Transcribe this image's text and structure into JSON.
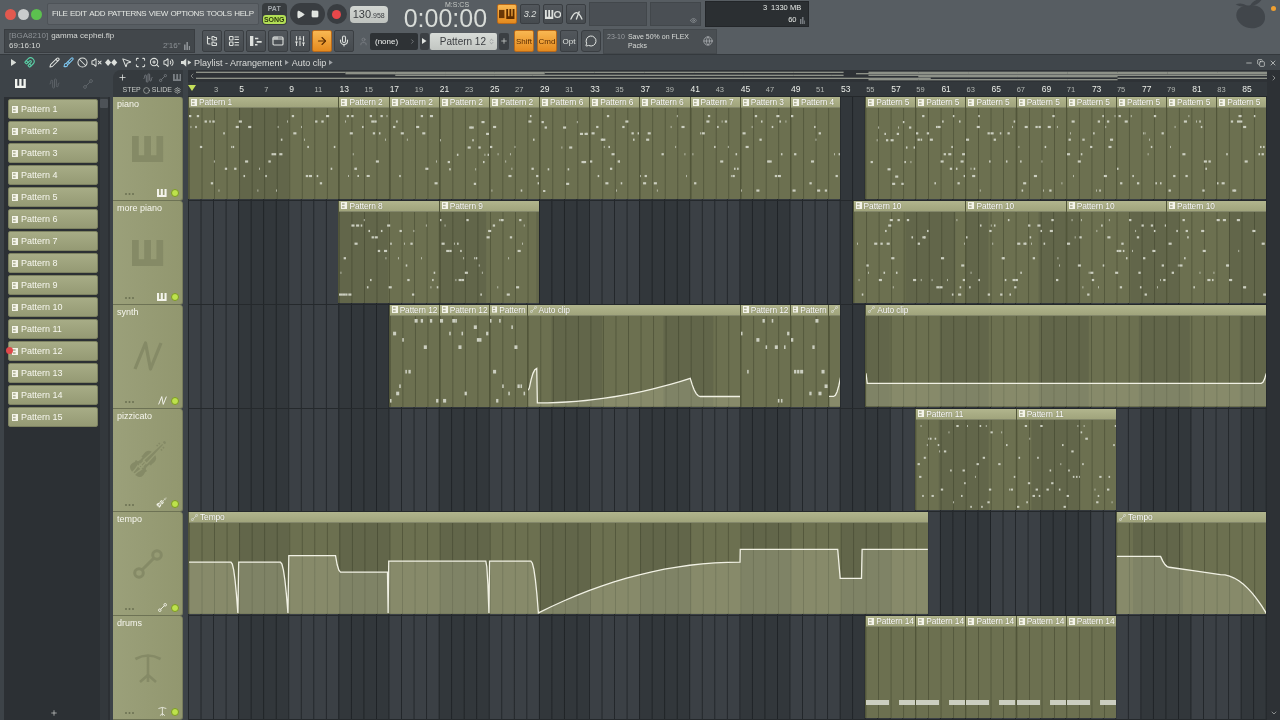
{
  "menu": [
    "FILE",
    "EDIT",
    "ADD",
    "PATTERNS",
    "VIEW",
    "OPTIONS",
    "TOOLS",
    "HELP"
  ],
  "transport": {
    "modes": [
      {
        "label": "PAT",
        "selected": false
      },
      {
        "label": "SONG",
        "selected": true
      }
    ],
    "tempo": "130",
    "tempo_fraction": ".958",
    "time_format": "M:S:CS",
    "time": "0:00:00"
  },
  "view_buttons": [
    {
      "kind": "keyboard",
      "on": true
    },
    {
      "kind": "countdown",
      "label": "3.2",
      "on": false
    },
    {
      "kind": "loop",
      "on": false
    },
    {
      "kind": "metronome",
      "on": false
    }
  ],
  "performance": {
    "cpu": "3",
    "memory": "1330 MB",
    "polyphony": "60"
  },
  "project": {
    "id": "[BGA8210]",
    "file": "gamma cephei.flp",
    "position": "69:16:10",
    "length": "2'16\""
  },
  "window_buttons": [
    {
      "kind": "browser",
      "on": false
    },
    {
      "kind": "channel_rack",
      "on": false
    },
    {
      "kind": "piano_roll",
      "on": false
    },
    {
      "kind": "playlist",
      "on": false
    },
    {
      "kind": "mixer",
      "on": false
    },
    {
      "kind": "arrow",
      "on": true
    },
    {
      "kind": "mic",
      "on": false
    }
  ],
  "channel_selector": "(none)",
  "pattern_selector": "Pattern 12",
  "modifier_keys": [
    {
      "label": "Shift",
      "on": true
    },
    {
      "label": "Cmd",
      "on": true
    },
    {
      "label": "Opt",
      "on": false
    }
  ],
  "news": {
    "date": "23-10",
    "text": "Save 50% on FLEX Packs"
  },
  "playlist": {
    "snap": {
      "on": true
    },
    "tools": [
      {
        "kind": "draw",
        "selected": false
      },
      {
        "kind": "paint",
        "selected": true
      },
      {
        "kind": "delete",
        "selected": false
      },
      {
        "kind": "mute",
        "selected": false
      },
      {
        "kind": "slip",
        "selected": false
      },
      {
        "kind": "select",
        "selected": false
      },
      {
        "kind": "zoom_fit",
        "selected": false
      },
      {
        "kind": "zoom",
        "selected": false
      },
      {
        "kind": "playback",
        "selected": false
      }
    ],
    "breadcrumb": [
      "Playlist - Arrangement",
      "Auto clip"
    ],
    "picker_tabs": [
      {
        "kind": "patterns",
        "selected": true
      },
      {
        "kind": "audio",
        "selected": false
      },
      {
        "kind": "automation",
        "selected": false
      }
    ],
    "patterns": [
      {
        "name": "Pattern 1",
        "selected": false
      },
      {
        "name": "Pattern 2",
        "selected": false
      },
      {
        "name": "Pattern 3",
        "selected": false
      },
      {
        "name": "Pattern 4",
        "selected": false
      },
      {
        "name": "Pattern 5",
        "selected": false
      },
      {
        "name": "Pattern 6",
        "selected": false
      },
      {
        "name": "Pattern 7",
        "selected": false
      },
      {
        "name": "Pattern 8",
        "selected": false
      },
      {
        "name": "Pattern 9",
        "selected": false
      },
      {
        "name": "Pattern 10",
        "selected": false
      },
      {
        "name": "Pattern 11",
        "selected": false
      },
      {
        "name": "Pattern 12",
        "selected": true
      },
      {
        "name": "Pattern 13",
        "selected": false
      },
      {
        "name": "Pattern 14",
        "selected": false
      },
      {
        "name": "Pattern 15",
        "selected": false
      }
    ],
    "header_options": {
      "step": "STEP",
      "slide": "SLIDE"
    },
    "ruler": [
      "3",
      "5",
      "7",
      "9",
      "11",
      "13",
      "15",
      "17",
      "19",
      "21",
      "23",
      "25",
      "27",
      "29",
      "31",
      "33",
      "35",
      "37",
      "39",
      "41",
      "43",
      "45",
      "47",
      "49",
      "51",
      "53",
      "55",
      "57",
      "59",
      "61",
      "63",
      "65",
      "67",
      "69",
      "71",
      "73",
      "75",
      "77",
      "79",
      "81",
      "83",
      "85"
    ],
    "tracks": [
      {
        "name": "piano",
        "kind": "piano",
        "active": true,
        "clips": [
          {
            "kind": "pattern",
            "label": "Pattern 1"
          },
          {
            "kind": "pattern",
            "label": "Pattern 2"
          },
          {
            "kind": "pattern",
            "label": "Pattern 2"
          },
          {
            "kind": "pattern",
            "label": "Pattern 2"
          },
          {
            "kind": "pattern",
            "label": "Pattern 2"
          },
          {
            "kind": "pattern",
            "label": "Pattern 6"
          },
          {
            "kind": "pattern",
            "label": "Pattern 6"
          },
          {
            "kind": "pattern",
            "label": "Pattern 6"
          },
          {
            "kind": "pattern",
            "label": "Pattern 7"
          },
          {
            "kind": "pattern",
            "label": "Pattern 3"
          },
          {
            "kind": "pattern",
            "label": "Pattern 4"
          },
          {
            "kind": "pattern",
            "label": "Pattern 5"
          },
          {
            "kind": "pattern",
            "label": "Pattern 5"
          },
          {
            "kind": "pattern",
            "label": "Pattern 5"
          },
          {
            "kind": "pattern",
            "label": "Pattern 5"
          },
          {
            "kind": "pattern",
            "label": "Pattern 5"
          },
          {
            "kind": "pattern",
            "label": "Pattern 5"
          },
          {
            "kind": "pattern",
            "label": "Pattern 5"
          },
          {
            "kind": "pattern",
            "label": "Pattern 5"
          }
        ]
      },
      {
        "name": "more piano",
        "kind": "piano",
        "active": true,
        "clips": [
          {
            "kind": "pattern",
            "label": "Pattern 8"
          },
          {
            "kind": "pattern",
            "label": "Pattern 9"
          },
          {
            "kind": "pattern",
            "label": "Pattern 10"
          },
          {
            "kind": "pattern",
            "label": "Pattern 10"
          },
          {
            "kind": "pattern",
            "label": "Pattern 10"
          },
          {
            "kind": "pattern",
            "label": "Pattern 10"
          }
        ]
      },
      {
        "name": "synth",
        "kind": "synth",
        "active": true,
        "clips": [
          {
            "kind": "pattern",
            "label": "Pattern 12"
          },
          {
            "kind": "pattern",
            "label": "Pattern 12"
          },
          {
            "kind": "pattern",
            "label": "Pattern"
          },
          {
            "kind": "automation",
            "label": "Auto clip"
          },
          {
            "kind": "pattern",
            "label": "Pattern 12"
          },
          {
            "kind": "pattern",
            "label": "Pattern"
          },
          {
            "kind": "automation"
          },
          {
            "kind": "automation",
            "label": "Auto clip"
          }
        ]
      },
      {
        "name": "pizzicato",
        "kind": "strings",
        "active": true,
        "clips": [
          {
            "kind": "pattern",
            "label": "Pattern 11"
          },
          {
            "kind": "pattern",
            "label": "Pattern 11"
          }
        ]
      },
      {
        "name": "tempo",
        "kind": "automation",
        "active": true,
        "clips": [
          {
            "kind": "automation",
            "label": "Tempo"
          },
          {
            "kind": "automation",
            "label": "Tempo"
          }
        ]
      },
      {
        "name": "drums",
        "kind": "drums",
        "active": true,
        "clips": [
          {
            "kind": "pattern",
            "label": "Pattern 14"
          },
          {
            "kind": "pattern",
            "label": "Pattern 14"
          },
          {
            "kind": "pattern",
            "label": "Pattern 14"
          },
          {
            "kind": "pattern",
            "label": "Pattern 14"
          },
          {
            "kind": "pattern",
            "label": "Pattern 14"
          }
        ]
      }
    ]
  }
}
